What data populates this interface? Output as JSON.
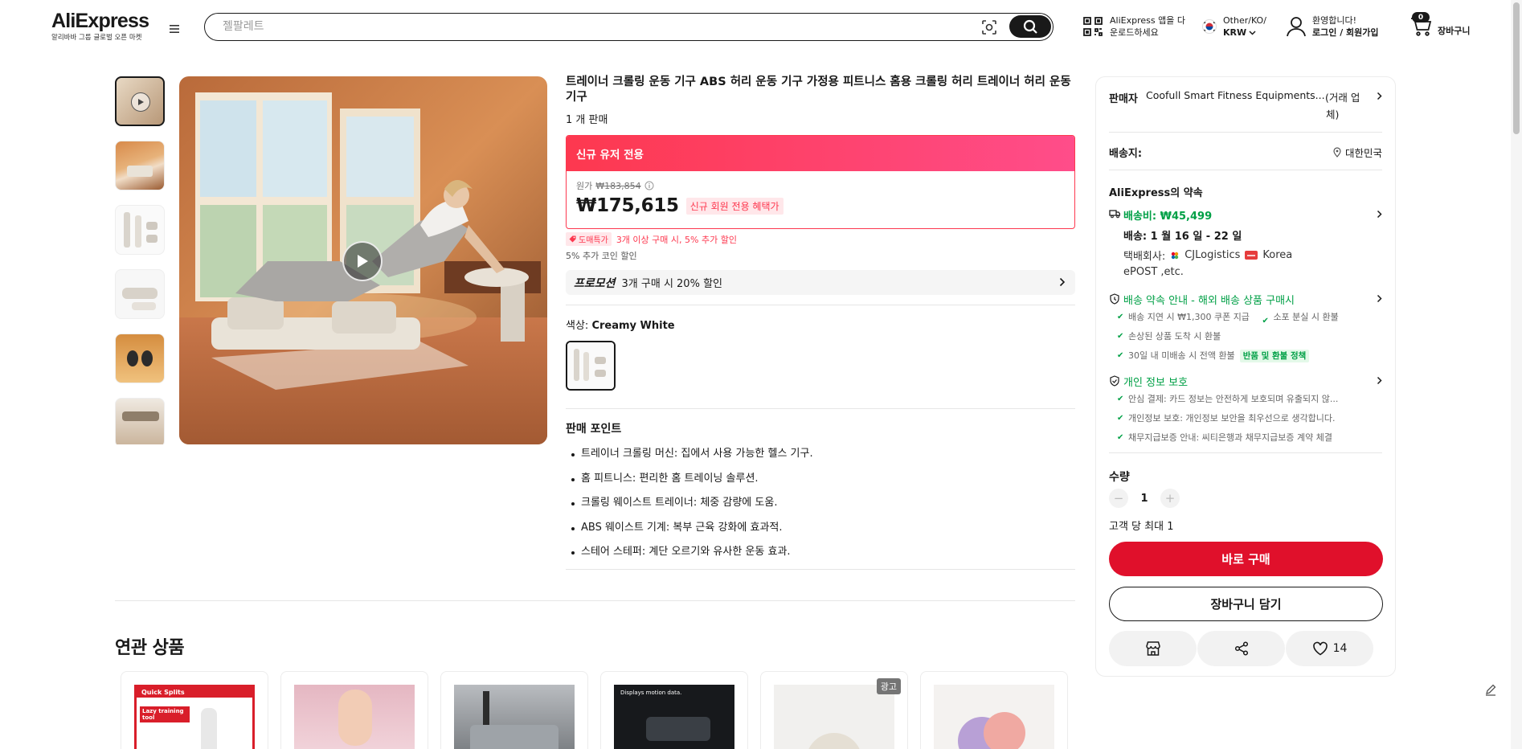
{
  "header": {
    "logo": "AliExpress",
    "logo_sub": "알리바바 그룹 글로벌 오픈 마켓",
    "search_placeholder": "젤팔레트",
    "app_line1": "AliExpress 앱을 다",
    "app_line2": "운로드하세요",
    "region_line1": "Other/KO/",
    "region_line2": "KRW",
    "welcome": "환영합니다!",
    "login": "로그인 / 회원가입",
    "cart_count": "0",
    "cart_label": "장바구니"
  },
  "product": {
    "title": "트레이너 크롤링 운동 기구 ABS 허리 운동 기구 가정용 피트니스 홈용 크롤링 허리 트레이너 허리 운동 기구",
    "sold": "1 개 판매",
    "new_user_band": "신규 유저 전용",
    "original_label": "원가",
    "original_price": "₩183,854",
    "price": "₩175,615",
    "price_tag": "신규 회원 전용 혜택가",
    "bulk_tag": "도매특가",
    "bulk_text": "3개 이상 구매 시, 5% 추가 할인",
    "coin_text": "5% 추가 코인 할인",
    "promo_label": "프로모션",
    "promo_text": "3개 구매 시 20% 할인",
    "color_label": "색상:",
    "color_value": "Creamy White",
    "points_title": "판매 포인트",
    "points": [
      "트레이너 크롤링 머신: 집에서 사용 가능한 헬스 기구.",
      "홈 피트니스: 편리한 홈 트레이닝 솔루션.",
      "크롤링 웨이스트 트레이너: 체중 감량에 도움.",
      "ABS 웨이스트 기계: 복부 근육 강화에 효과적.",
      "스테어 스테퍼: 계단 오르기와 유사한 운동 효과."
    ]
  },
  "panel": {
    "seller_label": "판매자",
    "seller_name": "Coofull Smart Fitness Equipments...",
    "seller_type_1": "(거래 업",
    "seller_type_2": "체)",
    "ship_to_label": "배송지:",
    "ship_to": "대한민국",
    "promise_title": "AliExpress의 약속",
    "shipping_fee": "배송비: ₩45,499",
    "delivery": "배송: 1 월 16 일 - 22 일",
    "carrier_label": "택배회사:",
    "carrier_1": "CJLogistics",
    "carrier_2": "Korea",
    "carrier_3": "ePOST ,etc.",
    "guarantee_title": "배송 약속 안내 - 해외 배송 상품 구매시",
    "guarantee_items": [
      "배송 지연 시 ₩1,300 쿠폰 지급",
      "소포 분실 시 환불",
      "손상된 상품 도착 시 환불",
      "30일 내 미배송 시 전액 환불"
    ],
    "refund_tag": "반품 및 환불 정책",
    "privacy_title": "개인 정보 보호",
    "privacy_items": [
      "안심 결제: 카드 정보는 안전하게 보호되며 유출되지 않...",
      "개인정보 보호: 개인정보 보안을 최우선으로 생각합니다.",
      "채무지급보증 안내: 씨티은행과 채무지급보증 계약 체결"
    ],
    "qty_label": "수량",
    "qty_value": "1",
    "qty_limit": "고객 당 최대 1",
    "buy_now": "바로 구매",
    "add_cart": "장바구니 담기",
    "wish_count": "14"
  },
  "related": {
    "title": "연관 상품",
    "ad_badge": "광고",
    "card1_banner": "Quick Splits",
    "card1_sub": "Lazy training tool",
    "card4_text": "Displays motion data."
  },
  "colors": {
    "accent_red": "#e0102b",
    "promo_pink": "#fd384f",
    "green": "#00a046"
  }
}
